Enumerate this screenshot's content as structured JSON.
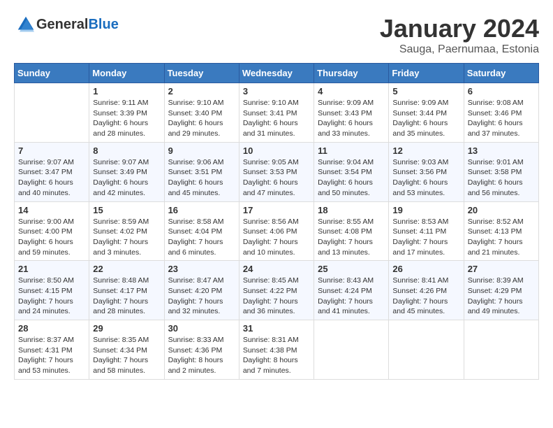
{
  "header": {
    "logo_general": "General",
    "logo_blue": "Blue",
    "month": "January 2024",
    "location": "Sauga, Paernumaa, Estonia"
  },
  "weekdays": [
    "Sunday",
    "Monday",
    "Tuesday",
    "Wednesday",
    "Thursday",
    "Friday",
    "Saturday"
  ],
  "weeks": [
    [
      {
        "day": "",
        "sunrise": "",
        "sunset": "",
        "daylight": ""
      },
      {
        "day": "1",
        "sunrise": "Sunrise: 9:11 AM",
        "sunset": "Sunset: 3:39 PM",
        "daylight": "Daylight: 6 hours and 28 minutes."
      },
      {
        "day": "2",
        "sunrise": "Sunrise: 9:10 AM",
        "sunset": "Sunset: 3:40 PM",
        "daylight": "Daylight: 6 hours and 29 minutes."
      },
      {
        "day": "3",
        "sunrise": "Sunrise: 9:10 AM",
        "sunset": "Sunset: 3:41 PM",
        "daylight": "Daylight: 6 hours and 31 minutes."
      },
      {
        "day": "4",
        "sunrise": "Sunrise: 9:09 AM",
        "sunset": "Sunset: 3:43 PM",
        "daylight": "Daylight: 6 hours and 33 minutes."
      },
      {
        "day": "5",
        "sunrise": "Sunrise: 9:09 AM",
        "sunset": "Sunset: 3:44 PM",
        "daylight": "Daylight: 6 hours and 35 minutes."
      },
      {
        "day": "6",
        "sunrise": "Sunrise: 9:08 AM",
        "sunset": "Sunset: 3:46 PM",
        "daylight": "Daylight: 6 hours and 37 minutes."
      }
    ],
    [
      {
        "day": "7",
        "sunrise": "Sunrise: 9:07 AM",
        "sunset": "Sunset: 3:47 PM",
        "daylight": "Daylight: 6 hours and 40 minutes."
      },
      {
        "day": "8",
        "sunrise": "Sunrise: 9:07 AM",
        "sunset": "Sunset: 3:49 PM",
        "daylight": "Daylight: 6 hours and 42 minutes."
      },
      {
        "day": "9",
        "sunrise": "Sunrise: 9:06 AM",
        "sunset": "Sunset: 3:51 PM",
        "daylight": "Daylight: 6 hours and 45 minutes."
      },
      {
        "day": "10",
        "sunrise": "Sunrise: 9:05 AM",
        "sunset": "Sunset: 3:53 PM",
        "daylight": "Daylight: 6 hours and 47 minutes."
      },
      {
        "day": "11",
        "sunrise": "Sunrise: 9:04 AM",
        "sunset": "Sunset: 3:54 PM",
        "daylight": "Daylight: 6 hours and 50 minutes."
      },
      {
        "day": "12",
        "sunrise": "Sunrise: 9:03 AM",
        "sunset": "Sunset: 3:56 PM",
        "daylight": "Daylight: 6 hours and 53 minutes."
      },
      {
        "day": "13",
        "sunrise": "Sunrise: 9:01 AM",
        "sunset": "Sunset: 3:58 PM",
        "daylight": "Daylight: 6 hours and 56 minutes."
      }
    ],
    [
      {
        "day": "14",
        "sunrise": "Sunrise: 9:00 AM",
        "sunset": "Sunset: 4:00 PM",
        "daylight": "Daylight: 6 hours and 59 minutes."
      },
      {
        "day": "15",
        "sunrise": "Sunrise: 8:59 AM",
        "sunset": "Sunset: 4:02 PM",
        "daylight": "Daylight: 7 hours and 3 minutes."
      },
      {
        "day": "16",
        "sunrise": "Sunrise: 8:58 AM",
        "sunset": "Sunset: 4:04 PM",
        "daylight": "Daylight: 7 hours and 6 minutes."
      },
      {
        "day": "17",
        "sunrise": "Sunrise: 8:56 AM",
        "sunset": "Sunset: 4:06 PM",
        "daylight": "Daylight: 7 hours and 10 minutes."
      },
      {
        "day": "18",
        "sunrise": "Sunrise: 8:55 AM",
        "sunset": "Sunset: 4:08 PM",
        "daylight": "Daylight: 7 hours and 13 minutes."
      },
      {
        "day": "19",
        "sunrise": "Sunrise: 8:53 AM",
        "sunset": "Sunset: 4:11 PM",
        "daylight": "Daylight: 7 hours and 17 minutes."
      },
      {
        "day": "20",
        "sunrise": "Sunrise: 8:52 AM",
        "sunset": "Sunset: 4:13 PM",
        "daylight": "Daylight: 7 hours and 21 minutes."
      }
    ],
    [
      {
        "day": "21",
        "sunrise": "Sunrise: 8:50 AM",
        "sunset": "Sunset: 4:15 PM",
        "daylight": "Daylight: 7 hours and 24 minutes."
      },
      {
        "day": "22",
        "sunrise": "Sunrise: 8:48 AM",
        "sunset": "Sunset: 4:17 PM",
        "daylight": "Daylight: 7 hours and 28 minutes."
      },
      {
        "day": "23",
        "sunrise": "Sunrise: 8:47 AM",
        "sunset": "Sunset: 4:20 PM",
        "daylight": "Daylight: 7 hours and 32 minutes."
      },
      {
        "day": "24",
        "sunrise": "Sunrise: 8:45 AM",
        "sunset": "Sunset: 4:22 PM",
        "daylight": "Daylight: 7 hours and 36 minutes."
      },
      {
        "day": "25",
        "sunrise": "Sunrise: 8:43 AM",
        "sunset": "Sunset: 4:24 PM",
        "daylight": "Daylight: 7 hours and 41 minutes."
      },
      {
        "day": "26",
        "sunrise": "Sunrise: 8:41 AM",
        "sunset": "Sunset: 4:26 PM",
        "daylight": "Daylight: 7 hours and 45 minutes."
      },
      {
        "day": "27",
        "sunrise": "Sunrise: 8:39 AM",
        "sunset": "Sunset: 4:29 PM",
        "daylight": "Daylight: 7 hours and 49 minutes."
      }
    ],
    [
      {
        "day": "28",
        "sunrise": "Sunrise: 8:37 AM",
        "sunset": "Sunset: 4:31 PM",
        "daylight": "Daylight: 7 hours and 53 minutes."
      },
      {
        "day": "29",
        "sunrise": "Sunrise: 8:35 AM",
        "sunset": "Sunset: 4:34 PM",
        "daylight": "Daylight: 7 hours and 58 minutes."
      },
      {
        "day": "30",
        "sunrise": "Sunrise: 8:33 AM",
        "sunset": "Sunset: 4:36 PM",
        "daylight": "Daylight: 8 hours and 2 minutes."
      },
      {
        "day": "31",
        "sunrise": "Sunrise: 8:31 AM",
        "sunset": "Sunset: 4:38 PM",
        "daylight": "Daylight: 8 hours and 7 minutes."
      },
      {
        "day": "",
        "sunrise": "",
        "sunset": "",
        "daylight": ""
      },
      {
        "day": "",
        "sunrise": "",
        "sunset": "",
        "daylight": ""
      },
      {
        "day": "",
        "sunrise": "",
        "sunset": "",
        "daylight": ""
      }
    ]
  ]
}
